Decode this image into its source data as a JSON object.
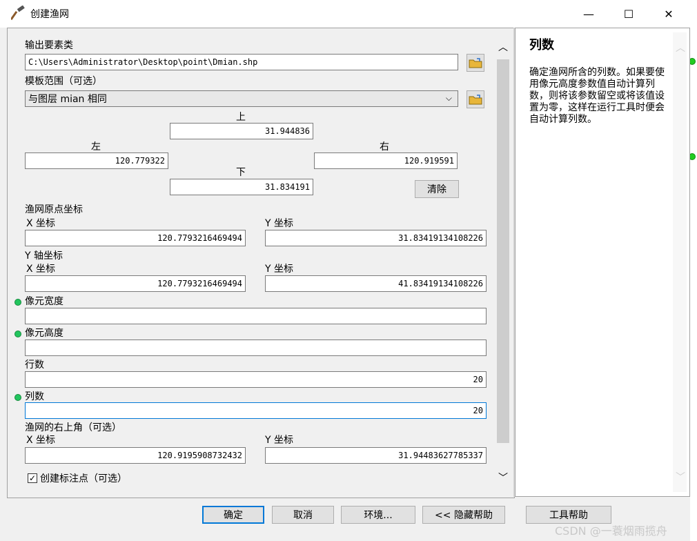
{
  "window": {
    "title": "创建渔网",
    "min_glyph": "—",
    "max_glyph": "☐",
    "close_glyph": "✕"
  },
  "form": {
    "output_label": "输出要素类",
    "output_value": "C:\\Users\\Administrator\\Desktop\\point\\Dmian.shp",
    "template_label": "模板范围（可选）",
    "template_value": "与图层 mian 相同",
    "extent": {
      "top_label": "上",
      "top_value": "31.944836",
      "left_label": "左",
      "left_value": "120.779322",
      "right_label": "右",
      "right_value": "120.919591",
      "bottom_label": "下",
      "bottom_value": "31.834191",
      "clear_label": "清除"
    },
    "origin_label": "渔网原点坐标",
    "origin_x_label": "X 坐标",
    "origin_x_value": "120.7793216469494",
    "origin_y_label": "Y 坐标",
    "origin_y_value": "31.83419134108226",
    "yaxis_label": "Y 轴坐标",
    "yaxis_x_label": "X 坐标",
    "yaxis_x_value": "120.7793216469494",
    "yaxis_y_label": "Y 坐标",
    "yaxis_y_value": "41.83419134108226",
    "cell_width_label": "像元宽度",
    "cell_width_value": "",
    "cell_height_label": "像元高度",
    "cell_height_value": "",
    "rows_label": "行数",
    "rows_value": "20",
    "cols_label": "列数",
    "cols_value": "20",
    "corner_label": "渔网的右上角（可选）",
    "corner_x_label": "X 坐标",
    "corner_x_value": "120.9195908732432",
    "corner_y_label": "Y 坐标",
    "corner_y_value": "31.94483627785337",
    "label_points_label": "创建标注点（可选）",
    "label_points_checked_glyph": "✓"
  },
  "help": {
    "title": "列数",
    "text": "确定渔网所含的列数。如果要使用像元高度参数值自动计算列数，则将该参数留空或将该值设置为零，这样在运行工具时便会自动计算列数。"
  },
  "buttons": {
    "ok": "确定",
    "cancel": "取消",
    "env": "环境...",
    "hide_help": "<< 隐藏帮助",
    "tool_help": "工具帮助"
  },
  "watermark": "CSDN @一蓑烟雨揽舟",
  "colors": {
    "required_dot": "#22c55e",
    "focus_border": "#0078d7"
  }
}
